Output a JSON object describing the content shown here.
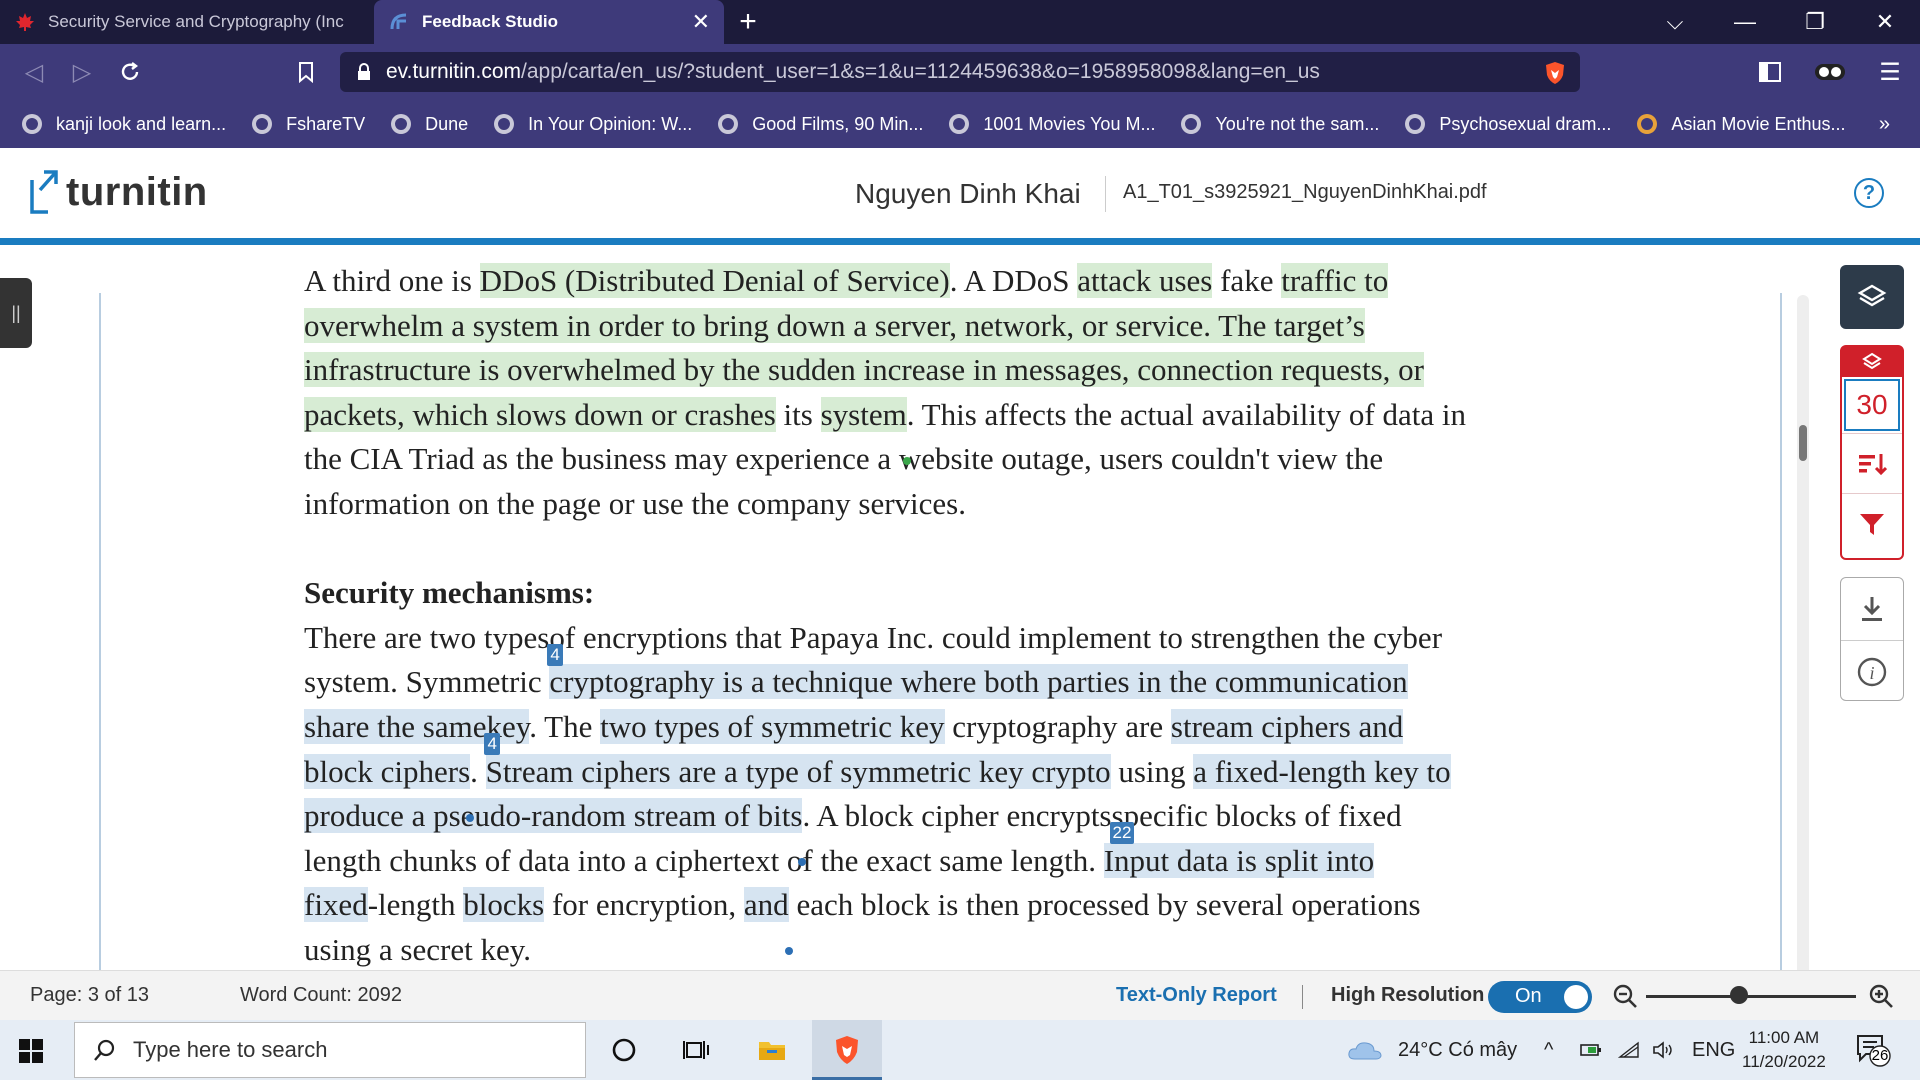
{
  "browser": {
    "tabs": [
      {
        "label": "Security Service and Cryptography (Inc",
        "active": false
      },
      {
        "label": "Feedback Studio",
        "active": true
      }
    ],
    "url_host": "ev.turnitin.com",
    "url_path": "/app/carta/en_us/?student_user=1&s=1&u=1124459638&o=1958958098&lang=en_us",
    "bookmarks": [
      "kanji look and learn...",
      "FshareTV",
      "Dune",
      "In Your Opinion: W...",
      "Good Films, 90 Min...",
      "1001 Movies You M...",
      "You're not the sam...",
      "Psychosexual dram...",
      "Asian Movie Enthus..."
    ]
  },
  "turnitin": {
    "logo_text": "turnitin",
    "student_name": "Nguyen Dinh Khai",
    "file_name": "A1_T01_s3925921_NguyenDinhKhai.pdf",
    "similarity_score": "30"
  },
  "document": {
    "p1": {
      "a": "A third one is ",
      "b": "DDoS (Distributed Denial of Service)",
      "c": ". A DDoS ",
      "d": "attack uses",
      "e": " fake ",
      "f": "traffic to",
      "g": "overwhelm a system in order to bring down a server, network, or service. The target’s",
      "h": "infrastructure is overwhelmed by the sudden increase in messages, connection requests, or",
      "i": "packets, which slows down or crashes",
      "j": " its ",
      "k": "system",
      "l": ". This affects the actual availability of data in",
      "m": "the CIA Triad as the business may experience a website outage, users couldn't view the",
      "n": "information on the page or use the company services."
    },
    "heading": "Security mechanisms:",
    "p2": {
      "a": "There are two types",
      "mk1": "4",
      "b": "of encryptions that Papaya Inc. could implement to strengthen the cyber",
      "c": "system. Symmetric ",
      "d": "cryptography is a technique where both parties in the communication",
      "e": "share the same",
      "mk2": "4",
      "f": "key",
      "g": ". The ",
      "h": "two types of symmetric key",
      "i": " cryptography are ",
      "j": "stream ciphers and",
      "k": "block ciphers",
      "l": ". ",
      "m": "Stream ciphers are a type of symmetric key crypto",
      "n": " using ",
      "o": "a fixed-length key to",
      "p": "produce a pseudo-random stream of bits",
      "q": ". A block cipher encrypts",
      "mk3": "22",
      "r": "specific blocks of fixed",
      "s": "length chunks of data into a ciphertext of the exact same length. ",
      "t": "Input data is split into",
      "u": "fixed",
      "v": "-length ",
      "w": "blocks",
      "x": " for encryption, ",
      "y": "and",
      "z": " each block is then processed by several operations",
      "last": "using a secret key."
    }
  },
  "statusbar": {
    "page": "Page: 3 of 13",
    "word_count": "Word Count: 2092",
    "text_only": "Text-Only Report",
    "high_res": "High Resolution",
    "toggle": "On"
  },
  "taskbar": {
    "search_placeholder": "Type here to search",
    "weather": "24°C  Có mây",
    "lang": "ENG",
    "time": "11:00 AM",
    "date": "11/20/2022",
    "notifications": "26"
  },
  "colors": {
    "accent": "#1a7cc0",
    "brand_red": "#d0202a",
    "match_green": "#d7ecd4",
    "match_blue": "#d6e4f1"
  }
}
